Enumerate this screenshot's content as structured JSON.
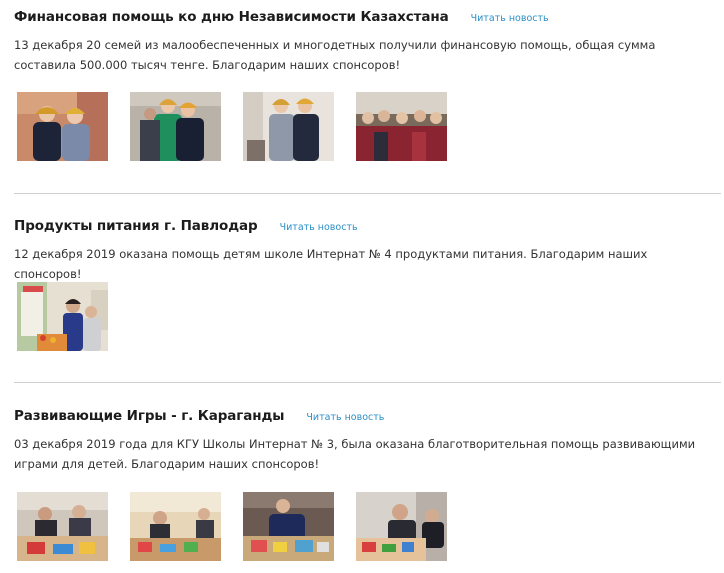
{
  "posts": [
    {
      "title": "Финансовая помощь ко дню Независимости Казахстана",
      "read_more": "Читать новость",
      "text": "13 декабря 20 семей из малообеспеченных и многодетных получили финансовую помощь, общая сумма составила 500.000 тысяч тенге. Благодарим наших спонсоров!"
    },
    {
      "title": "Продукты питания г. Павлодар",
      "read_more": "Читать новость",
      "text": "12 декабря 2019 оказана помощь детям школе Интернат № 4 продуктами питания. Благодарим наших спонсоров!"
    },
    {
      "title": "Развивающие Игры - г. Караганды",
      "read_more": "Читать новость",
      "text": "03 декабря 2019 года для КГУ Школы Интернат № 3, была оказана благотворительная помощь развивающими играми для детей. Благодарим наших спонсоров!"
    }
  ]
}
